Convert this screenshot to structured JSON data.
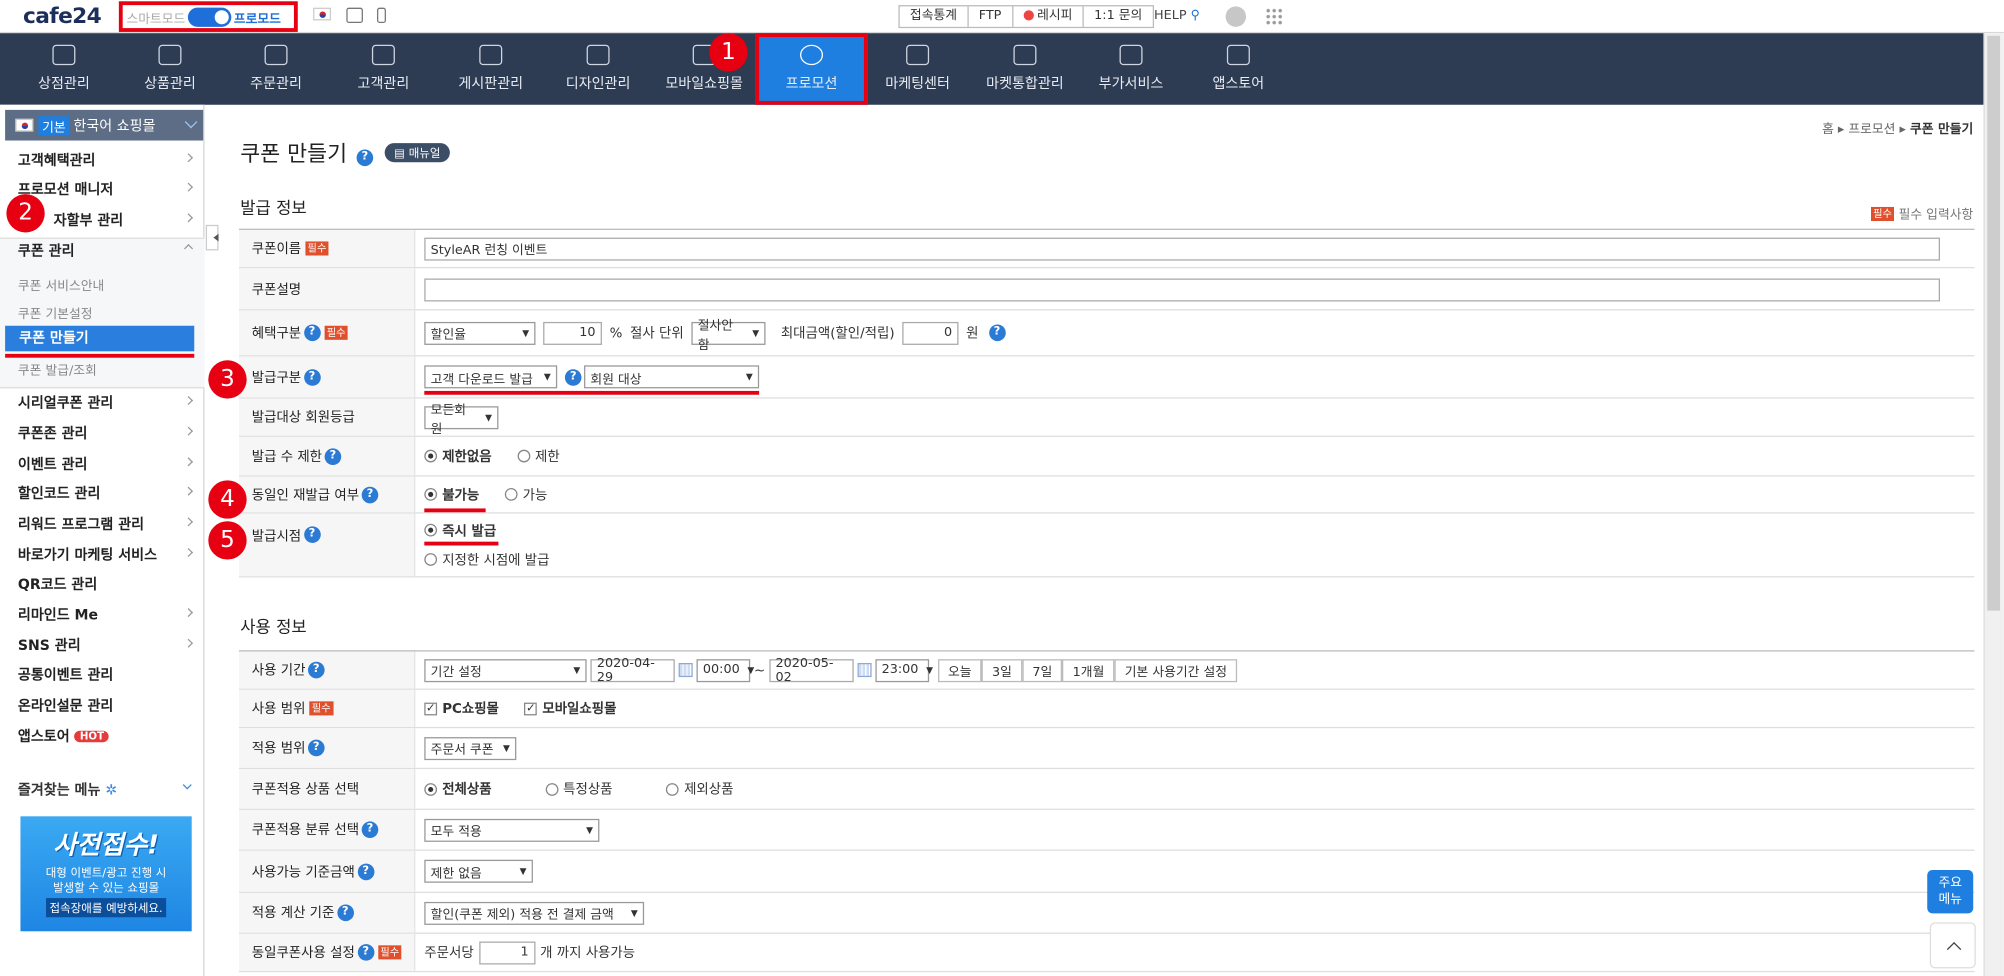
{
  "topbar": {
    "logo": "cafe24",
    "mode_left": "스마트모드",
    "mode_right": "프로모드",
    "links": [
      "접속통계",
      "FTP",
      "레시피",
      "1:1 문의"
    ],
    "help": "HELP"
  },
  "nav": [
    "상점관리",
    "상품관리",
    "주문관리",
    "고객관리",
    "게시판관리",
    "디자인관리",
    "모바일쇼핑몰",
    "프로모션",
    "마케팅센터",
    "마켓통합관리",
    "부가서비스",
    "앱스토어"
  ],
  "sidebar": {
    "badge": "기본",
    "shop": "한국어 쇼핑몰",
    "items": [
      "고객혜택관리",
      "프로모션 매니저",
      "자할부 관리",
      "쿠폰 관리"
    ],
    "subs": [
      "쿠폰 서비스안내",
      "쿠폰 기본설정",
      "쿠폰 만들기",
      "쿠폰 발급/조회"
    ],
    "items2": [
      "시리얼쿠폰 관리",
      "쿠폰존 관리",
      "이벤트 관리",
      "할인코드 관리",
      "리워드 프로그램 관리",
      "바로가기 마케팅 서비스",
      "QR코드 관리",
      "리마인드 Me",
      "SNS 관리",
      "공통이벤트 관리",
      "온라인설문 관리",
      "앱스토어"
    ],
    "hot": "HOT",
    "fav": "즐겨찾는 메뉴",
    "banner": {
      "title": "사전접수!",
      "line1": "대형 이벤트/광고 진행 시",
      "line2": "발생할 수 있는 쇼핑몰",
      "line3": "접속장애를 예방하세요."
    }
  },
  "main": {
    "breadcrumb": [
      "홈",
      "프로모션",
      "쿠폰 만들기"
    ],
    "title": "쿠폰 만들기",
    "manual": "매뉴얼",
    "issue_section": "발급 정보",
    "use_section": "사용 정보",
    "req_tag": "필수",
    "req_note": "필수 입력사항",
    "issue": {
      "name_label": "쿠폰이름",
      "name_value": "StyleAR 런칭 이벤트",
      "desc_label": "쿠폰설명",
      "benefit_label": "혜택구분",
      "benefit_type": "할인율",
      "benefit_value": "10",
      "pct": "%",
      "cut_label": "절사 단위",
      "cut_value": "절사안함",
      "max_label": "최대금액(할인/적립)",
      "max_value": "0",
      "won": "원",
      "kind_label": "발급구분",
      "kind_value": "고객 다운로드 발급",
      "target_value": "회원 대상",
      "grade_label": "발급대상 회원등급",
      "grade_value": "모든회원",
      "limit_label": "발급 수 제한",
      "limit_opt1": "제한없음",
      "limit_opt2": "제한",
      "reissue_label": "동일인 재발급 여부",
      "reissue_opt1": "불가능",
      "reissue_opt2": "가능",
      "time_label": "발급시점",
      "time_opt1": "즉시 발급",
      "time_opt2": "지정한 시점에 발급"
    },
    "use": {
      "period_label": "사용 기간",
      "period_type": "기간 설정",
      "start_date": "2020-04-29",
      "start_time": "00:00",
      "tilde": "~",
      "end_date": "2020-05-02",
      "end_time": "23:00",
      "quick": [
        "오늘",
        "3일",
        "7일",
        "1개월",
        "기본 사용기간 설정"
      ],
      "scope_label": "사용 범위",
      "scope_pc": "PC쇼핑몰",
      "scope_mobile": "모바일쇼핑몰",
      "apply_label": "적용 범위",
      "apply_value": "주문서 쿠폰",
      "product_label": "쿠폰적용 상품 선택",
      "product_opt1": "전체상품",
      "product_opt2": "특정상품",
      "product_opt3": "제외상품",
      "category_label": "쿠폰적용 분류 선택",
      "category_value": "모두 적용",
      "min_label": "사용가능 기준금액",
      "min_value": "제한 없음",
      "calc_label": "적용 계산 기준",
      "calc_value": "할인(쿠폰 제외) 적용 전 결제 금액",
      "same_label": "동일쿠폰사용 설정",
      "same_prefix": "주문서당",
      "same_value": "1",
      "same_suffix": "개 까지 사용가능"
    }
  },
  "quick_menu": "주요\n메뉴",
  "markers": [
    "1",
    "2",
    "3",
    "4",
    "5"
  ]
}
